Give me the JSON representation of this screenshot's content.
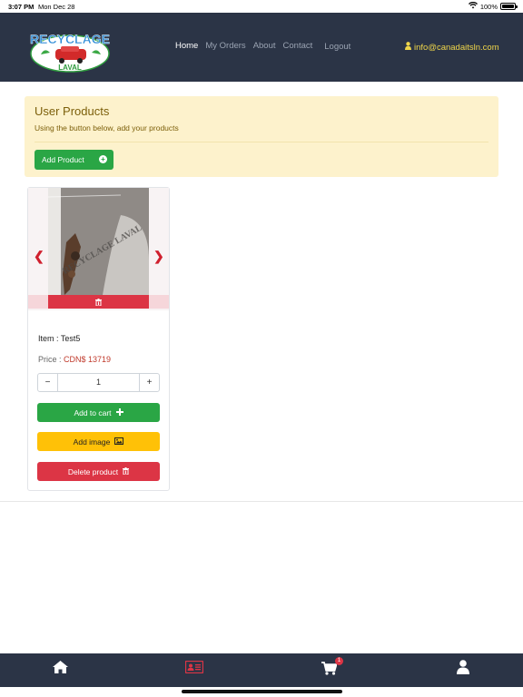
{
  "status_bar": {
    "time": "3:07 PM",
    "date": "Mon Dec 28",
    "battery": "100%",
    "battery_level": 1.0
  },
  "brand": {
    "logo_top": "RECYCLAGE",
    "logo_bottom": "LAVAL"
  },
  "nav": {
    "links": [
      {
        "label": "Home",
        "active": true
      },
      {
        "label": "My Orders",
        "active": false
      },
      {
        "label": "About",
        "active": false
      },
      {
        "label": "Contact",
        "active": false
      }
    ],
    "logout": "Logout",
    "email": "info@canadaitsln.com"
  },
  "alert": {
    "title": "User Products",
    "subtitle": "Using the button below, add your products",
    "add_button": "Add Product"
  },
  "product": {
    "watermark": "RECYCLAGE LAVAL",
    "item_label": "Item : ",
    "item_name": "Test5",
    "price_label": "Price : ",
    "price": "CDN$ 13719",
    "quantity": "1",
    "minus": "−",
    "plus": "+",
    "add_to_cart": "Add to cart",
    "add_image": "Add image",
    "delete_product": "Delete product"
  },
  "tabbar": {
    "cart_badge": "1"
  },
  "colors": {
    "navbar": "#2b3446",
    "accent_yellow": "#f0d64a",
    "success": "#2aa645",
    "warning": "#ffc107",
    "danger": "#dc3545"
  }
}
